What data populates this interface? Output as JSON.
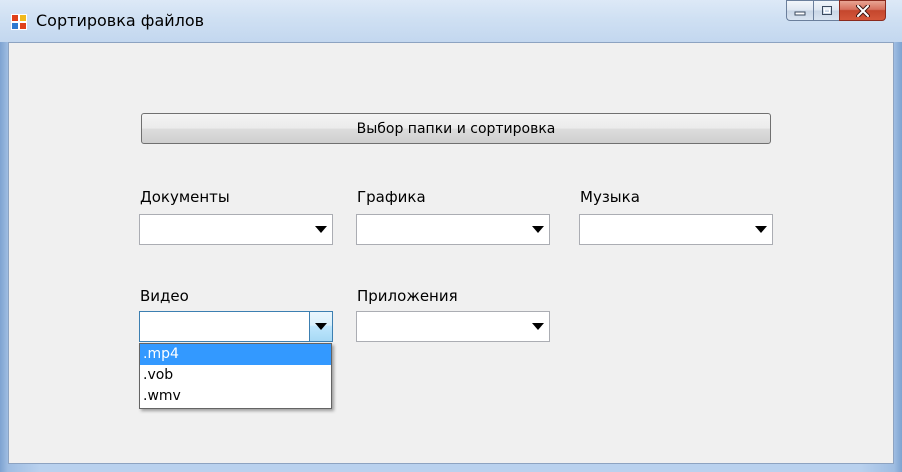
{
  "window": {
    "title": "Сортировка файлов",
    "icons": {
      "app": "app-window-icon",
      "minimize": "minimize-icon",
      "maximize": "maximize-icon",
      "close": "close-icon"
    },
    "colors": {
      "close_button": "#c4462d",
      "selection": "#3399ff"
    }
  },
  "form": {
    "sort_button_label": "Выбор папки и сортировка",
    "fields": {
      "documents": {
        "label": "Документы",
        "value": ""
      },
      "graphics": {
        "label": "Графика",
        "value": ""
      },
      "music": {
        "label": "Музыка",
        "value": ""
      },
      "video": {
        "label": "Видео",
        "value": ""
      },
      "apps": {
        "label": "Приложения",
        "value": ""
      }
    },
    "video_dropdown": {
      "options": [
        ".mp4",
        ".vob",
        ".wmv"
      ],
      "highlighted": ".mp4"
    }
  }
}
